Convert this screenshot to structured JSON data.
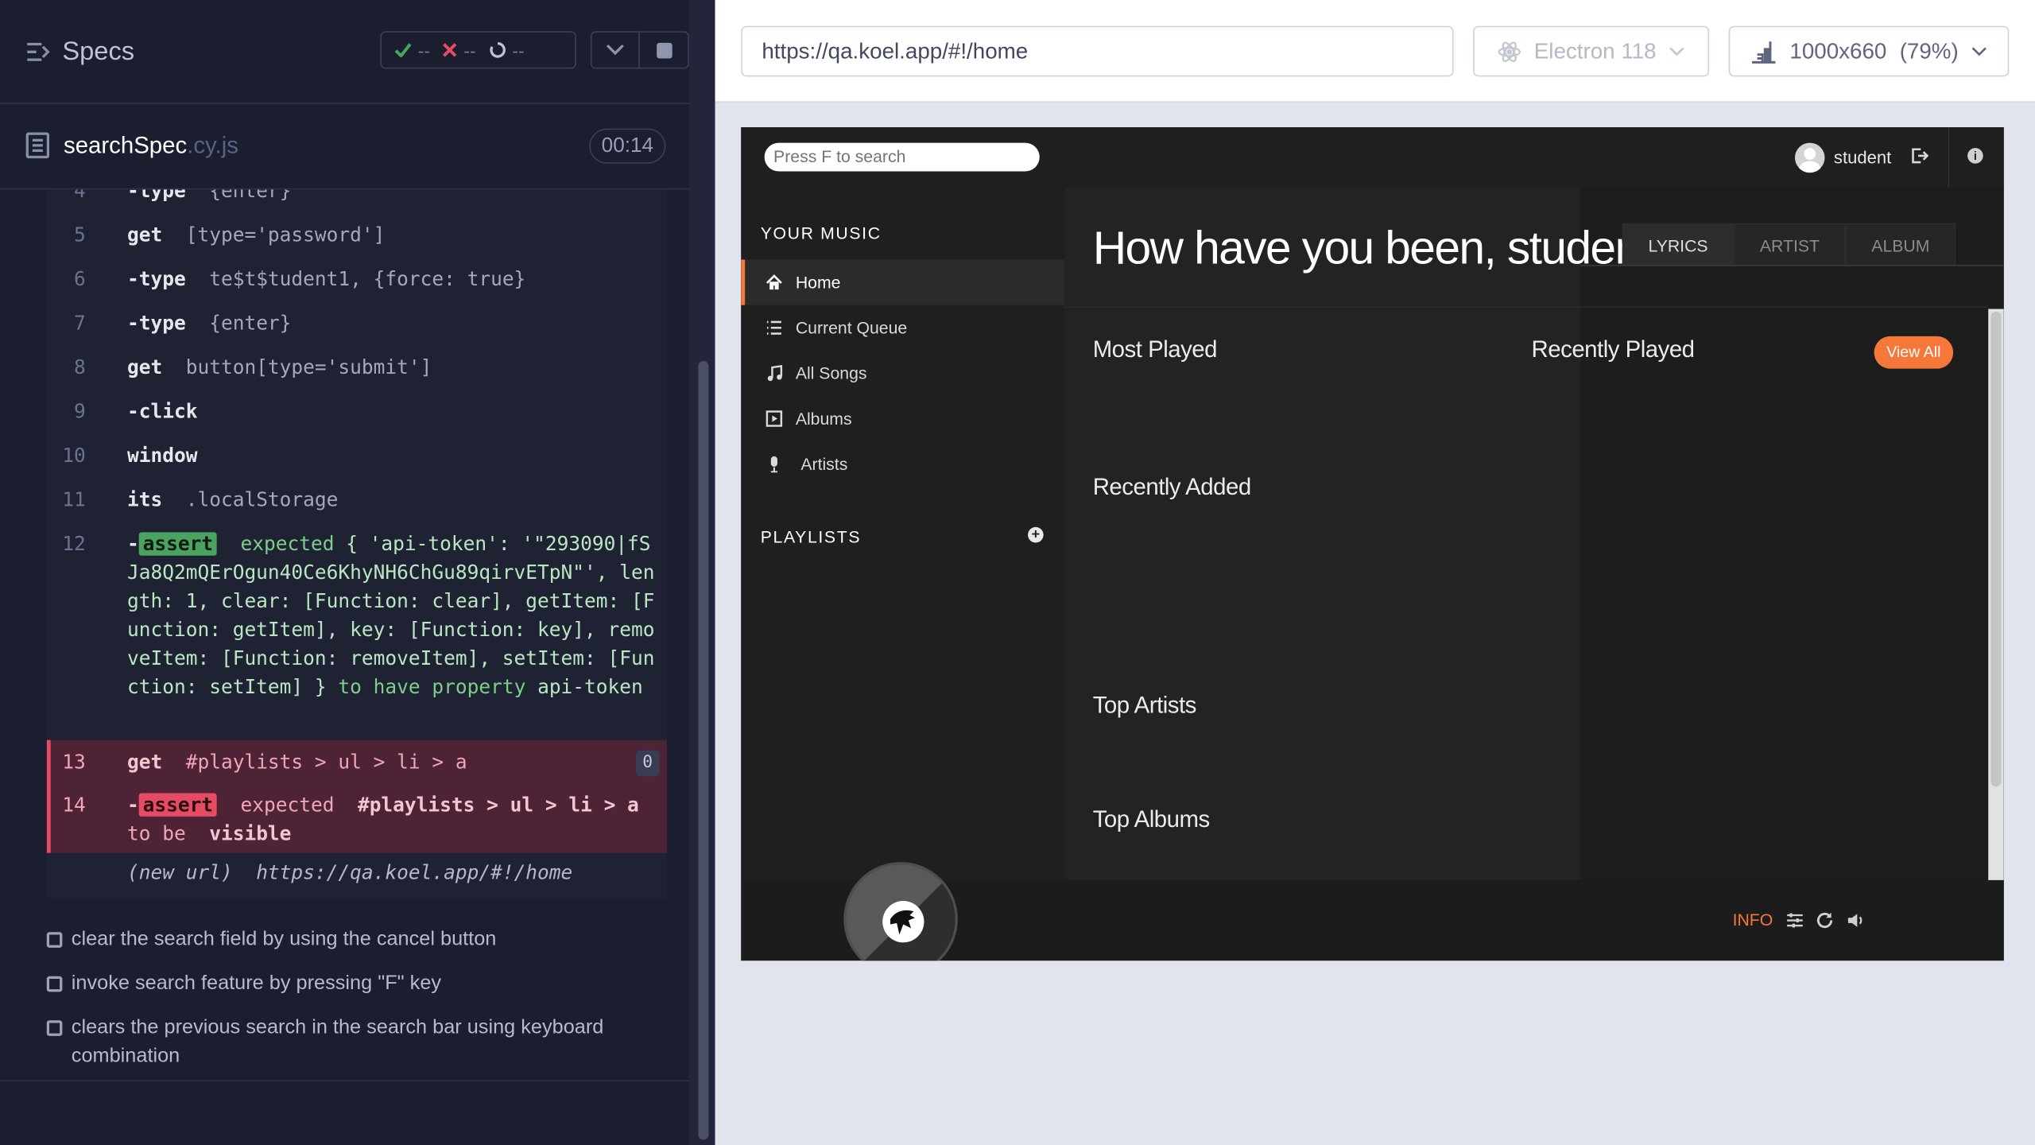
{
  "reporter": {
    "title": "Specs",
    "stats": {
      "passed": "--",
      "failed": "--",
      "pending": "--"
    },
    "file": {
      "name": "searchSpec",
      "ext": ".cy.js",
      "duration": "00:14"
    },
    "commands": [
      {
        "num": "4",
        "name": "-type",
        "message": "{enter}"
      },
      {
        "num": "5",
        "name": "get",
        "message": "[type='password']"
      },
      {
        "num": "6",
        "name": "-type",
        "message": "te$t$tudent1, {force: true}"
      },
      {
        "num": "7",
        "name": "-type",
        "message": "{enter}"
      },
      {
        "num": "8",
        "name": "get",
        "message": "button[type='submit']"
      },
      {
        "num": "9",
        "name": "-click",
        "message": ""
      },
      {
        "num": "10",
        "name": "window",
        "message": ""
      },
      {
        "num": "11",
        "name": "its",
        "message": ".localStorage"
      },
      {
        "num": "12",
        "name": "-",
        "badge": "assert",
        "expected": "expected",
        "message": "{ 'api-token': '\"293090|fSJa8Q2mQErOgun40Ce6KhyNH6ChGu89qirvETpN\"', length: 1, clear: [Function: clear], getItem: [Function: getItem], key: [Function: key], removeItem: [Function: removeItem], setItem: [Function: setItem] }",
        "to_have": "to have property",
        "property": "api-token"
      },
      {
        "num": "13",
        "name": "get",
        "message": "#playlists > ul > li > a",
        "count": "0"
      },
      {
        "num": "14",
        "name": "-",
        "badge": "assert",
        "expected": "expected",
        "selector": "#playlists > ul > li > a",
        "to_be": "to be",
        "property": "visible"
      }
    ],
    "new_url": {
      "label": "(new url)",
      "url": "https://qa.koel.app/#!/home"
    },
    "tests": [
      "clear the search field by using the cancel button",
      "invoke search feature by pressing \"F\" key",
      "clears the previous search in the search bar using keyboard combination"
    ]
  },
  "browser": {
    "url": "https://qa.koel.app/#!/home",
    "name": "Electron 118",
    "viewport": "1000x660",
    "scale": "(79%)"
  },
  "koel": {
    "search_placeholder": "Press F to search",
    "user": "student",
    "your_music": "YOUR MUSIC",
    "nav": [
      "Home",
      "Current Queue",
      "All Songs",
      "Albums",
      "Artists"
    ],
    "playlists": "PLAYLISTS",
    "greeting": "How have you been, student?",
    "tabs": [
      "LYRICS",
      "ARTIST",
      "ALBUM"
    ],
    "sections": {
      "most_played": "Most Played",
      "recently_played": "Recently Played",
      "view_all": "View All",
      "recently_added": "Recently Added",
      "top_artists": "Top Artists",
      "top_albums": "Top Albums"
    },
    "footer_info": "INFO",
    "accent": "#f5773a"
  },
  "colors": {
    "pass": "#4aa35e",
    "fail": "#e54b62",
    "reporter_bg": "#1b1e2e"
  }
}
